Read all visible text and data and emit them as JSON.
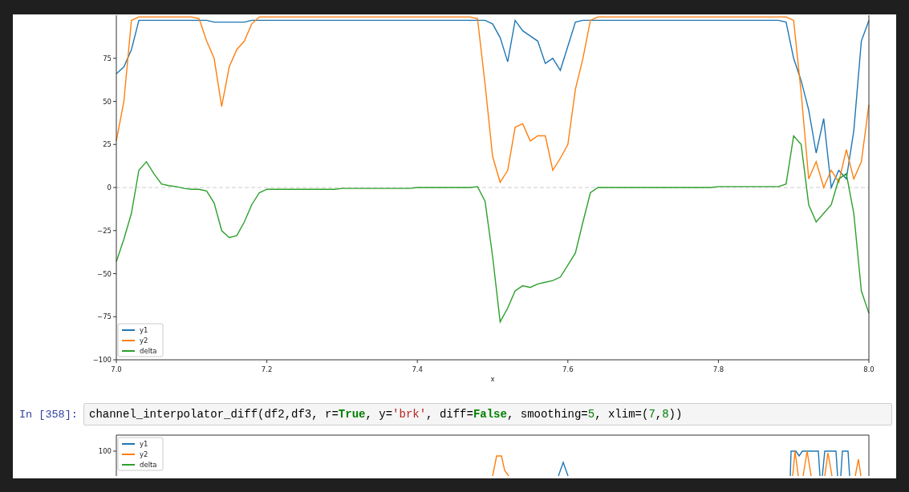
{
  "output_chart": {
    "chart_data": {
      "type": "line",
      "xlabel": "x",
      "x": [
        7.0,
        7.01,
        7.02,
        7.03,
        7.04,
        7.05,
        7.06,
        7.07,
        7.08,
        7.09,
        7.1,
        7.11,
        7.12,
        7.13,
        7.14,
        7.15,
        7.16,
        7.17,
        7.18,
        7.19,
        7.2,
        7.21,
        7.22,
        7.23,
        7.24,
        7.25,
        7.26,
        7.27,
        7.28,
        7.29,
        7.3,
        7.31,
        7.32,
        7.33,
        7.34,
        7.35,
        7.36,
        7.37,
        7.38,
        7.39,
        7.4,
        7.41,
        7.42,
        7.43,
        7.44,
        7.45,
        7.46,
        7.47,
        7.48,
        7.49,
        7.5,
        7.51,
        7.52,
        7.53,
        7.54,
        7.55,
        7.56,
        7.57,
        7.58,
        7.59,
        7.6,
        7.61,
        7.62,
        7.63,
        7.64,
        7.65,
        7.66,
        7.67,
        7.68,
        7.69,
        7.7,
        7.71,
        7.72,
        7.73,
        7.74,
        7.75,
        7.76,
        7.77,
        7.78,
        7.79,
        7.8,
        7.81,
        7.82,
        7.83,
        7.84,
        7.85,
        7.86,
        7.87,
        7.88,
        7.89,
        7.9,
        7.91,
        7.92,
        7.93,
        7.94,
        7.95,
        7.96,
        7.97,
        7.98,
        7.99,
        8.0
      ],
      "series": [
        {
          "name": "y1",
          "color": "#1f77b4",
          "values": [
            66,
            70,
            80,
            97,
            97,
            97,
            97,
            97,
            97,
            97,
            97,
            97,
            97,
            96,
            96,
            96,
            96,
            96,
            97,
            97,
            97,
            97,
            97,
            97,
            97,
            97,
            97,
            97,
            97,
            97,
            97,
            97,
            97,
            97,
            97,
            97,
            97,
            97,
            97,
            97,
            97,
            97,
            97,
            97,
            97,
            97,
            97,
            97,
            97,
            97,
            95,
            87,
            73,
            97,
            91,
            88,
            85,
            72,
            75,
            68,
            82,
            96,
            97,
            97,
            97,
            97,
            97,
            97,
            97,
            97,
            97,
            97,
            97,
            97,
            97,
            97,
            97,
            97,
            97,
            97,
            97,
            97,
            97,
            97,
            97,
            97,
            97,
            97,
            97,
            96,
            75,
            62,
            45,
            20,
            40,
            0,
            10,
            5,
            33,
            85,
            97
          ]
        },
        {
          "name": "y2",
          "color": "#ff7f0e",
          "values": [
            27,
            50,
            97,
            99,
            99,
            99,
            99,
            99,
            99,
            99,
            99,
            98,
            85,
            75,
            47,
            70,
            80,
            85,
            95,
            99,
            99,
            99,
            99,
            99,
            99,
            99,
            99,
            99,
            99,
            99,
            99,
            99,
            99,
            99,
            99,
            99,
            99,
            99,
            99,
            99,
            99,
            99,
            99,
            99,
            99,
            99,
            99,
            99,
            98,
            60,
            18,
            3,
            10,
            35,
            37,
            27,
            30,
            30,
            10,
            17,
            25,
            57,
            75,
            97,
            99,
            99,
            99,
            99,
            99,
            99,
            99,
            99,
            99,
            99,
            99,
            99,
            99,
            99,
            99,
            99,
            99,
            99,
            99,
            99,
            99,
            99,
            99,
            99,
            99,
            99,
            97,
            55,
            5,
            15,
            0,
            10,
            3,
            22,
            5,
            15,
            48
          ]
        },
        {
          "name": "delta",
          "color": "#2ca02c",
          "values": [
            -43,
            -30,
            -15,
            10,
            15,
            8,
            2,
            1,
            0.5,
            -0.5,
            -1,
            -1,
            -2,
            -9,
            -25,
            -29,
            -28,
            -20,
            -10,
            -3,
            -1,
            -1,
            -1,
            -1,
            -1,
            -1,
            -1,
            -1,
            -1,
            -1,
            -0.5,
            -0.5,
            -0.5,
            -0.5,
            -0.5,
            -0.5,
            -0.5,
            -0.5,
            -0.5,
            -0.5,
            0,
            0,
            0,
            0,
            0,
            0,
            0,
            0,
            0.5,
            -8,
            -40,
            -78,
            -70,
            -60,
            -57,
            -58,
            -56,
            -55,
            -54,
            -52,
            -45,
            -38,
            -20,
            -3,
            0,
            0,
            0,
            0,
            0,
            0,
            0,
            0,
            0,
            0,
            0,
            0,
            0,
            0,
            0,
            0,
            0.5,
            0.5,
            0.5,
            0.5,
            0.5,
            0.5,
            0.5,
            0.5,
            0.5,
            2,
            30,
            25,
            -10,
            -20,
            -15,
            -10,
            5,
            8,
            -15,
            -60,
            -73
          ]
        }
      ],
      "xlim": [
        7,
        8
      ],
      "ylim": [
        -100,
        100
      ],
      "xticks": [
        {
          "value": 7,
          "label": "7.0"
        },
        {
          "value": 7.2,
          "label": "7.2"
        },
        {
          "value": 7.4,
          "label": "7.4"
        },
        {
          "value": 7.6,
          "label": "7.6"
        },
        {
          "value": 7.8,
          "label": "7.8"
        },
        {
          "value": 8,
          "label": "8.0"
        }
      ],
      "yticks": [
        {
          "value": -100,
          "label": "−100"
        },
        {
          "value": -75,
          "label": "−75"
        },
        {
          "value": -50,
          "label": "−50"
        },
        {
          "value": -25,
          "label": "−25"
        },
        {
          "value": 0,
          "label": "0"
        },
        {
          "value": 25,
          "label": "25"
        },
        {
          "value": 50,
          "label": "50"
        },
        {
          "value": 75,
          "label": "75"
        }
      ],
      "ref_lines": [
        {
          "axis": "y",
          "value": 0
        }
      ],
      "legend": "lower left"
    }
  },
  "input_cell": {
    "prompt": "In [358]:",
    "code": [
      {
        "kind": "plain",
        "text": "channel_interpolator_diff(df2,df3, r="
      },
      {
        "kind": "keyword",
        "text": "True"
      },
      {
        "kind": "plain",
        "text": ", y="
      },
      {
        "kind": "string",
        "text": "'brk'"
      },
      {
        "kind": "plain",
        "text": ", diff="
      },
      {
        "kind": "keyword",
        "text": "False"
      },
      {
        "kind": "plain",
        "text": ", smoothing="
      },
      {
        "kind": "number",
        "text": "5"
      },
      {
        "kind": "plain",
        "text": ", xlim=("
      },
      {
        "kind": "number",
        "text": "7"
      },
      {
        "kind": "plain",
        "text": ","
      },
      {
        "kind": "number",
        "text": "8"
      },
      {
        "kind": "plain",
        "text": "))"
      }
    ]
  },
  "next_chart": {
    "ytick": "100",
    "legend": [
      {
        "label": "y1",
        "color": "#1f77b4"
      },
      {
        "label": "y2",
        "color": "#ff7f0e"
      },
      {
        "label": "delta",
        "color": "#2ca02c"
      }
    ]
  }
}
